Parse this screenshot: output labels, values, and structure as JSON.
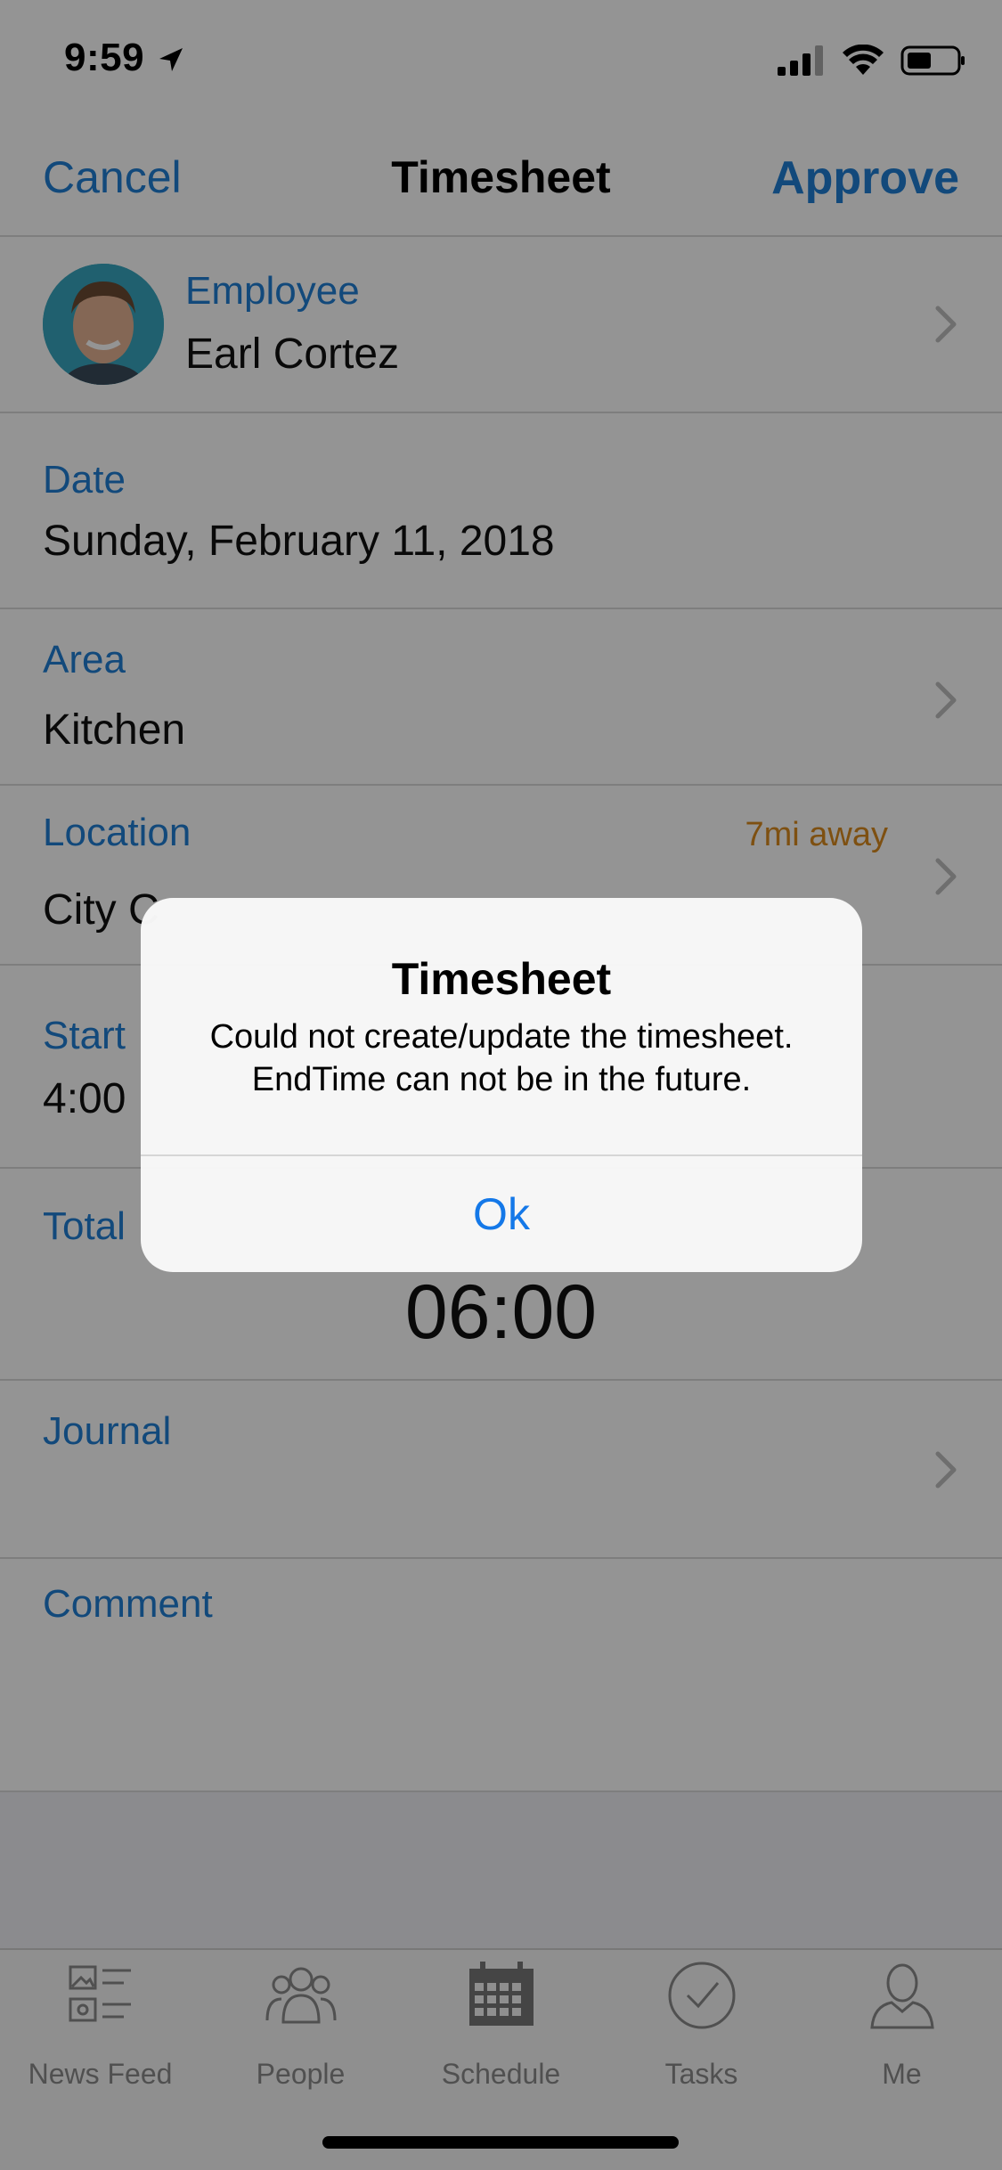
{
  "status_bar": {
    "time": "9:59"
  },
  "nav": {
    "cancel": "Cancel",
    "title": "Timesheet",
    "approve": "Approve"
  },
  "fields": {
    "employee": {
      "label": "Employee",
      "value": "Earl Cortez"
    },
    "date": {
      "label": "Date",
      "value": "Sunday, February 11, 2018"
    },
    "area": {
      "label": "Area",
      "value": "Kitchen"
    },
    "location": {
      "label": "Location",
      "distance": "7mi away",
      "value": "City C"
    },
    "start": {
      "label": "Start",
      "value": "4:00"
    },
    "total": {
      "label": "Total",
      "value": "06:00"
    },
    "journal": {
      "label": "Journal"
    },
    "comment": {
      "label": "Comment"
    }
  },
  "alert": {
    "title": "Timesheet",
    "message_line1": "Could not create/update the timesheet.",
    "message_line2": "EndTime can not be in the future.",
    "button": "Ok"
  },
  "tabs": [
    {
      "label": "News Feed",
      "icon": "news-feed-icon"
    },
    {
      "label": "People",
      "icon": "people-icon"
    },
    {
      "label": "Schedule",
      "icon": "schedule-icon"
    },
    {
      "label": "Tasks",
      "icon": "tasks-icon"
    },
    {
      "label": "Me",
      "icon": "me-icon"
    }
  ],
  "colors": {
    "accent": "#1f7fd4",
    "distance": "#d98a1e",
    "alert_button": "#1478e8"
  }
}
